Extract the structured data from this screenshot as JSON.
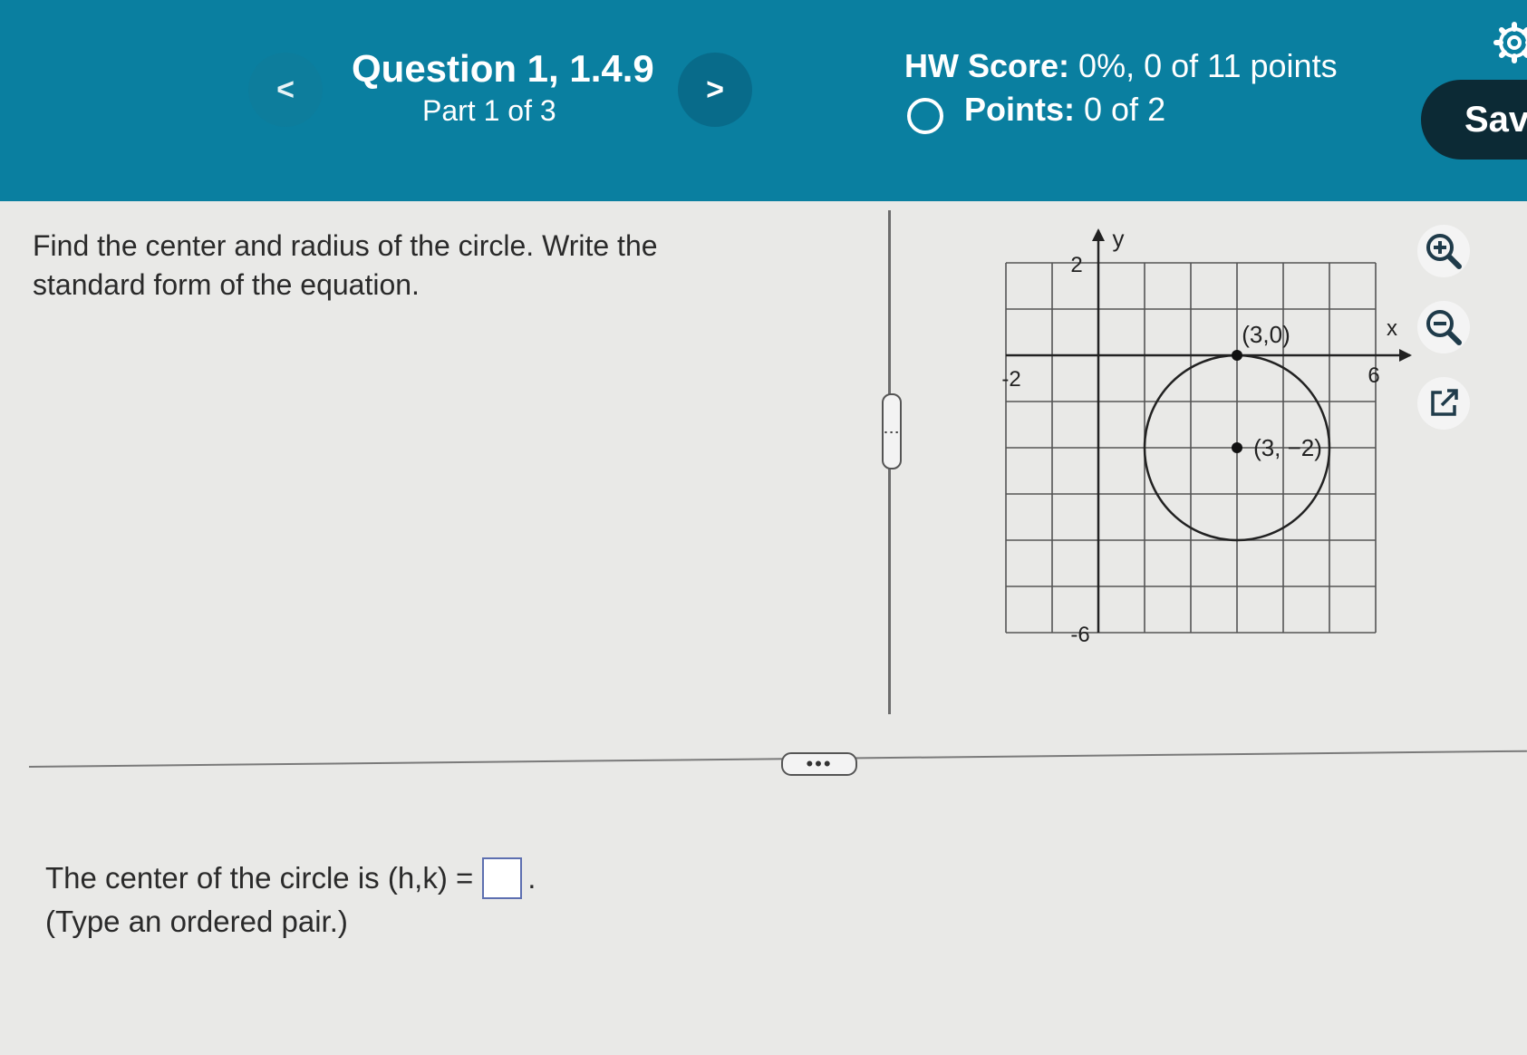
{
  "header": {
    "prev_label": "<",
    "next_label": ">",
    "question_title": "Question 1, 1.4.9",
    "part_label": "Part 1 of 3",
    "hw_score_label": "HW Score:",
    "hw_score_value": "0%, 0 of 11 points",
    "points_label": "Points:",
    "points_value": "0 of 2",
    "save_label": "Sav",
    "icons": {
      "prev": "chevron-left-icon",
      "next": "chevron-right-icon",
      "status": "circle-icon",
      "settings": "gear-icon"
    }
  },
  "prompt": {
    "text": "Find the center and radius of the circle. Write the standard form of the equation."
  },
  "dividers": {
    "vertical_handle": "⋮",
    "horizontal_handle": "•••"
  },
  "graph": {
    "axis_x_label": "x",
    "axis_y_label": "y",
    "tick_y_top": "2",
    "tick_x_left": "-2",
    "tick_x_right": "6",
    "tick_y_bottom": "-6",
    "point_top_label": "(3,0)",
    "point_center_label": "(3, −2)",
    "x_range": [
      -2,
      6
    ],
    "y_range": [
      -6,
      2
    ],
    "circle": {
      "center": [
        3,
        -2
      ],
      "radius": 2
    },
    "points": [
      [
        3,
        0
      ],
      [
        3,
        -2
      ]
    ]
  },
  "tools": {
    "zoom_in": "zoom-in-icon",
    "zoom_out": "zoom-out-icon",
    "popout": "external-link-icon"
  },
  "answer": {
    "prefix": "The center of the circle is (h,k) =",
    "suffix": ".",
    "hint": "(Type an ordered pair.)",
    "value": ""
  },
  "colors": {
    "header_bg": "#0a7fa0",
    "save_bg": "#0c2a35",
    "page_bg": "#e9e9e7"
  }
}
